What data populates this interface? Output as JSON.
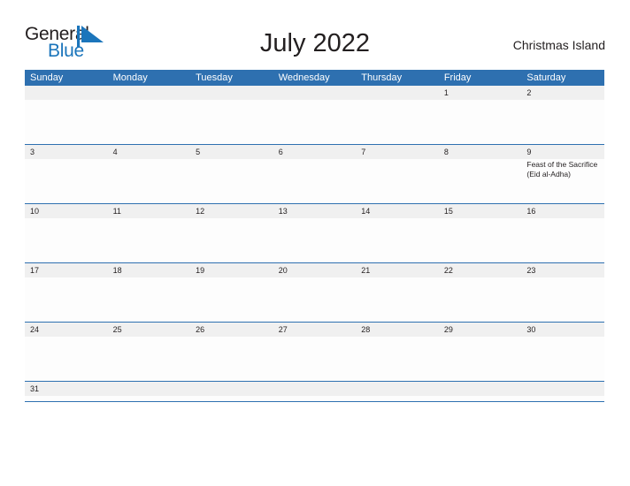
{
  "brand": {
    "name_part1": "General",
    "name_part2": "Blue",
    "flag_icon": "triangle-flag-icon",
    "color_black": "#231f20",
    "color_blue": "#1b75bb"
  },
  "header": {
    "title": "July 2022",
    "location": "Christmas Island"
  },
  "calendar": {
    "header_bg": "#2e70b0",
    "daynum_bg": "#f0f0f0",
    "border_color": "#2e70b0",
    "day_names": [
      "Sunday",
      "Monday",
      "Tuesday",
      "Wednesday",
      "Thursday",
      "Friday",
      "Saturday"
    ],
    "weeks": [
      [
        {
          "day": "",
          "events": []
        },
        {
          "day": "",
          "events": []
        },
        {
          "day": "",
          "events": []
        },
        {
          "day": "",
          "events": []
        },
        {
          "day": "",
          "events": []
        },
        {
          "day": "1",
          "events": []
        },
        {
          "day": "2",
          "events": []
        }
      ],
      [
        {
          "day": "3",
          "events": []
        },
        {
          "day": "4",
          "events": []
        },
        {
          "day": "5",
          "events": []
        },
        {
          "day": "6",
          "events": []
        },
        {
          "day": "7",
          "events": []
        },
        {
          "day": "8",
          "events": []
        },
        {
          "day": "9",
          "events": [
            "Feast of the Sacrifice (Eid al-Adha)"
          ]
        }
      ],
      [
        {
          "day": "10",
          "events": []
        },
        {
          "day": "11",
          "events": []
        },
        {
          "day": "12",
          "events": []
        },
        {
          "day": "13",
          "events": []
        },
        {
          "day": "14",
          "events": []
        },
        {
          "day": "15",
          "events": []
        },
        {
          "day": "16",
          "events": []
        }
      ],
      [
        {
          "day": "17",
          "events": []
        },
        {
          "day": "18",
          "events": []
        },
        {
          "day": "19",
          "events": []
        },
        {
          "day": "20",
          "events": []
        },
        {
          "day": "21",
          "events": []
        },
        {
          "day": "22",
          "events": []
        },
        {
          "day": "23",
          "events": []
        }
      ],
      [
        {
          "day": "24",
          "events": []
        },
        {
          "day": "25",
          "events": []
        },
        {
          "day": "26",
          "events": []
        },
        {
          "day": "27",
          "events": []
        },
        {
          "day": "28",
          "events": []
        },
        {
          "day": "29",
          "events": []
        },
        {
          "day": "30",
          "events": []
        }
      ],
      [
        {
          "day": "31",
          "events": []
        },
        {
          "day": "",
          "events": []
        },
        {
          "day": "",
          "events": []
        },
        {
          "day": "",
          "events": []
        },
        {
          "day": "",
          "events": []
        },
        {
          "day": "",
          "events": []
        },
        {
          "day": "",
          "events": []
        }
      ]
    ]
  }
}
